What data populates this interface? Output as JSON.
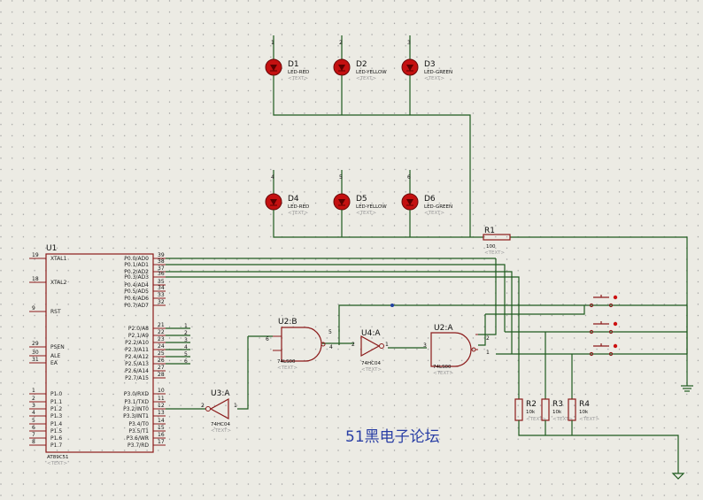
{
  "watermark": "51黑电子论坛",
  "placeholder": "<TEXT>",
  "leds": [
    {
      "ref": "D1",
      "part": "LED-RED",
      "pin": "1"
    },
    {
      "ref": "D2",
      "part": "LED-YELLOW",
      "pin": "2"
    },
    {
      "ref": "D3",
      "part": "LED-GREEN",
      "pin": "3"
    },
    {
      "ref": "D4",
      "part": "LED-RED",
      "pin": "4"
    },
    {
      "ref": "D5",
      "part": "LED-YELLOW",
      "pin": "5"
    },
    {
      "ref": "D6",
      "part": "LED-GREEN",
      "pin": "6"
    }
  ],
  "resistors": [
    {
      "ref": "R1",
      "value": "100"
    },
    {
      "ref": "R2",
      "value": "10k"
    },
    {
      "ref": "R3",
      "value": "10k"
    },
    {
      "ref": "R4",
      "value": "10k"
    }
  ],
  "gates": [
    {
      "ref": "U2:B",
      "part": "74LS00",
      "pins": [
        "5",
        "6",
        "4"
      ]
    },
    {
      "ref": "U4:A",
      "part": "74HC04",
      "pins": [
        "2",
        "1"
      ]
    },
    {
      "ref": "U2:A",
      "part": "74LS00",
      "pins": [
        "3",
        "2",
        "1"
      ]
    },
    {
      "ref": "U3:A",
      "part": "74HC04",
      "pins": [
        "2",
        "1"
      ]
    }
  ],
  "mcu": {
    "ref": "U1",
    "part": "AT89C51",
    "left_pins": [
      {
        "num": "19",
        "name": "XTAL1"
      },
      {
        "num": "18",
        "name": "XTAL2"
      },
      {
        "num": "9",
        "name": "RST"
      },
      {
        "num": "29",
        "name": "PSEN"
      },
      {
        "num": "30",
        "name": "ALE"
      },
      {
        "num": "31",
        "name": "EA"
      },
      {
        "num": "1",
        "name": "P1.0"
      },
      {
        "num": "2",
        "name": "P1.1"
      },
      {
        "num": "3",
        "name": "P1.2"
      },
      {
        "num": "4",
        "name": "P1.3"
      },
      {
        "num": "5",
        "name": "P1.4"
      },
      {
        "num": "6",
        "name": "P1.5"
      },
      {
        "num": "7",
        "name": "P1.6"
      },
      {
        "num": "8",
        "name": "P1.7"
      }
    ],
    "right_pins": [
      {
        "num": "39",
        "name": "P0.0/AD0"
      },
      {
        "num": "38",
        "name": "P0.1/AD1"
      },
      {
        "num": "37",
        "name": "P0.2/AD2"
      },
      {
        "num": "36",
        "name": "P0.3/AD3"
      },
      {
        "num": "35",
        "name": "P0.4/AD4"
      },
      {
        "num": "34",
        "name": "P0.5/AD5"
      },
      {
        "num": "33",
        "name": "P0.6/AD6"
      },
      {
        "num": "32",
        "name": "P0.7/AD7"
      },
      {
        "num": "21",
        "name": "P2.0/A8"
      },
      {
        "num": "22",
        "name": "P2.1/A9"
      },
      {
        "num": "23",
        "name": "P2.2/A10"
      },
      {
        "num": "24",
        "name": "P2.3/A11"
      },
      {
        "num": "25",
        "name": "P2.4/A12"
      },
      {
        "num": "26",
        "name": "P2.5/A13"
      },
      {
        "num": "27",
        "name": "P2.6/A14"
      },
      {
        "num": "28",
        "name": "P2.7/A15"
      },
      {
        "num": "10",
        "name": "P3.0/RXD"
      },
      {
        "num": "11",
        "name": "P3.1/TXD"
      },
      {
        "num": "12",
        "name": "P3.2/INT0"
      },
      {
        "num": "13",
        "name": "P3.3/INT1"
      },
      {
        "num": "14",
        "name": "P3.4/T0"
      },
      {
        "num": "15",
        "name": "P3.5/T1"
      },
      {
        "num": "16",
        "name": "P3.6/WR"
      },
      {
        "num": "17",
        "name": "P3.7/RD"
      }
    ]
  },
  "p2_net_labels": [
    "1",
    "2",
    "3",
    "4",
    "5",
    "6"
  ]
}
